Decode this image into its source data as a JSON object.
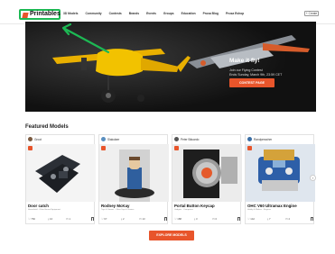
{
  "logo": {
    "text": "Printables"
  },
  "nav": {
    "items": [
      "3D Models",
      "Community",
      "Contests",
      "Brands",
      "Events",
      "Groups",
      "Education",
      "Prusa Blog",
      "Prusa Eshop"
    ],
    "create_label": "+ Create"
  },
  "hero": {
    "title": "Make it fly!",
    "line1": "Join our Flying Contest",
    "line2": "Ends Sunday, March 9th, 23:59 CET",
    "button": "CONTEST PAGE"
  },
  "featured": {
    "title": "Featured Models",
    "cards": [
      {
        "author": "Groot",
        "title": "Door catch",
        "meta": "Household · Other House Equipment",
        "likes": "766",
        "downloads": "10",
        "comments": "1"
      },
      {
        "author": "Slakolaer",
        "title": "Rodney McKay",
        "meta": "Toys & Games · Other Toys & Games",
        "likes": "67",
        "downloads": "2",
        "comments": "13"
      },
      {
        "author": "Peter Bäcardo",
        "title": "Portal Button Keycap",
        "meta": "Gadgets · Computers",
        "likes": "188",
        "downloads": "3",
        "comments": "0"
      },
      {
        "author": "Randpreacher",
        "title": "OHC V60 Ultramax Engine",
        "meta": "Hobby & Makers · Engines",
        "likes": "142",
        "downloads": "7",
        "comments": "2"
      }
    ]
  },
  "explore_button": "EXPLORE MODELS",
  "colors": {
    "accent": "#e8552b",
    "highlight": "#1db954",
    "hero_bg": "#141414"
  },
  "icons": [
    "logo-icon",
    "heart-icon",
    "download-icon",
    "comment-icon",
    "bookmark-icon",
    "chevron-right-icon",
    "verified-icon"
  ]
}
